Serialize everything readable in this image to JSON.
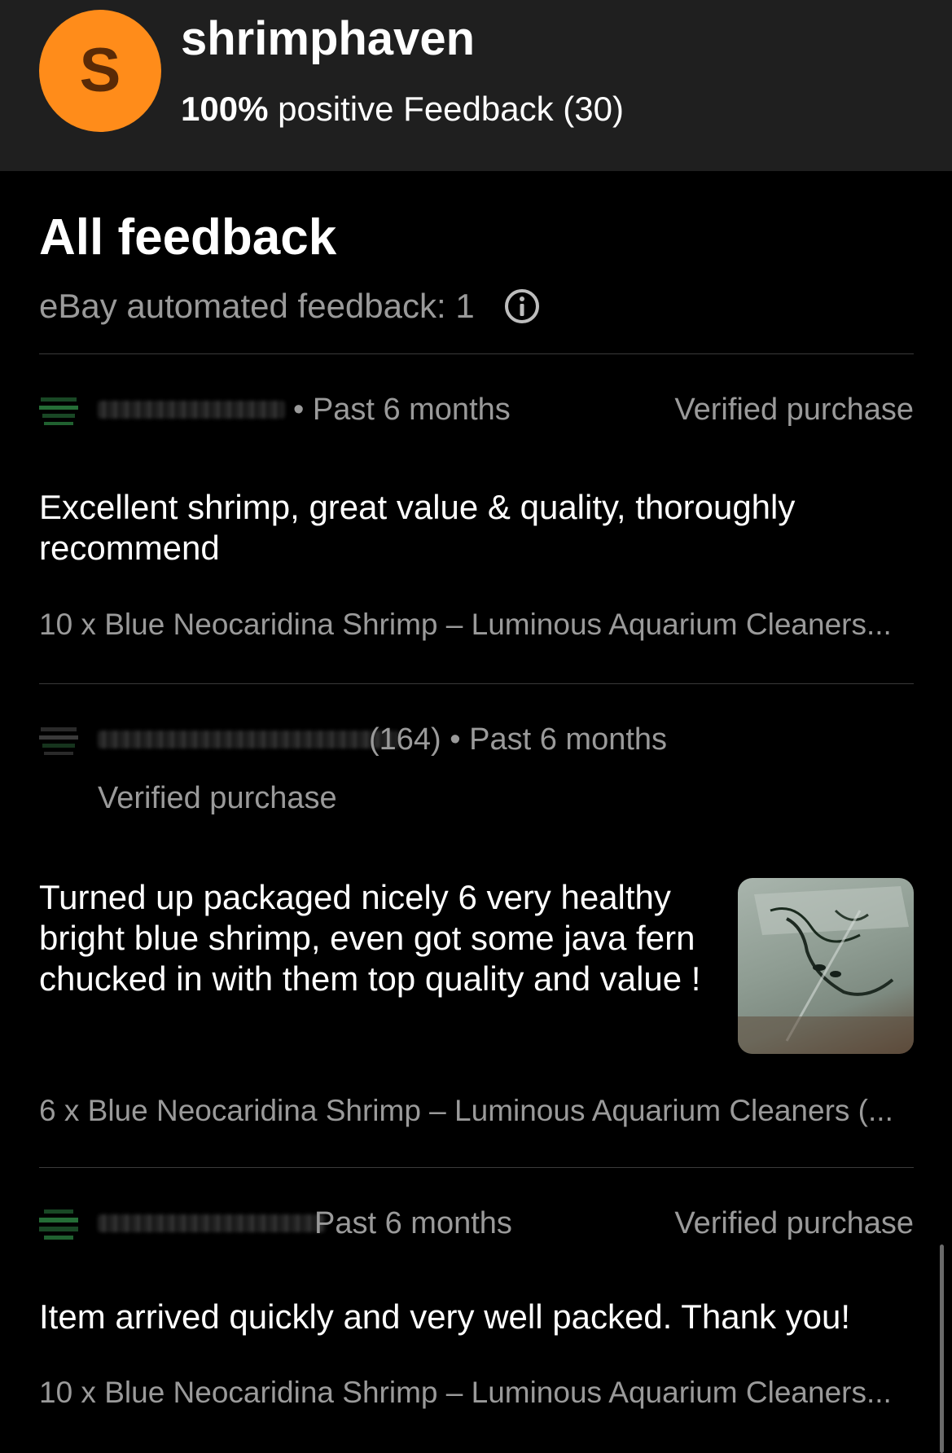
{
  "seller": {
    "avatar_letter": "S",
    "name": "shrimphaven",
    "positive_pct": "100%",
    "feedback_text": "positive Feedback (30)"
  },
  "section": {
    "title": "All feedback",
    "automated_label": "eBay automated feedback: 1"
  },
  "entries": [
    {
      "meta": "• Past 6 months",
      "verified": "Verified purchase",
      "comment": "Excellent shrimp, great value & quality, thoroughly recommend",
      "item": "10 x Blue Neocaridina Shrimp – Luminous Aquarium Cleaners..."
    },
    {
      "meta": "(164) • Past 6 months",
      "verified": "Verified purchase",
      "comment": "Turned up packaged nicely 6 very healthy bright blue shrimp, even got some java fern chucked in with them top quality and value !",
      "item": "6 x Blue Neocaridina Shrimp – Luminous Aquarium Cleaners (..."
    },
    {
      "meta": "Past 6 months",
      "verified": "Verified purchase",
      "comment": "Item arrived quickly and very well packed. Thank you!",
      "item": "10 x Blue Neocaridina Shrimp – Luminous Aquarium Cleaners..."
    }
  ],
  "colors": {
    "header_bg": "#1f1f1f",
    "page_bg": "#000000",
    "avatar_bg": "#ff8c1a",
    "secondary_text": "#9a9a9a"
  },
  "icons": [
    "info-icon",
    "user-icon"
  ]
}
